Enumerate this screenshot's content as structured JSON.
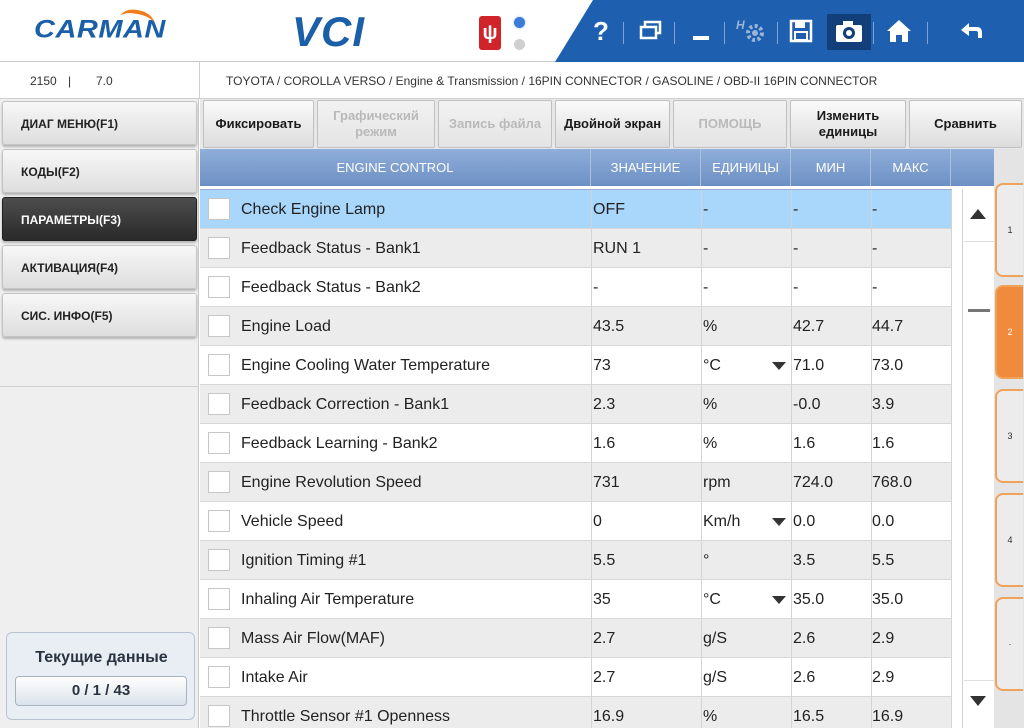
{
  "header": {
    "logo": "CARMAN",
    "product": "VCI",
    "toolbar": [
      "help-icon",
      "window-icon",
      "minimize-icon",
      "settings-icon",
      "save-icon",
      "camera-icon",
      "home-icon",
      "back-icon"
    ]
  },
  "infobar": {
    "version_a": "2150",
    "version_sep": "|",
    "version_b": "7.0",
    "breadcrumb": "TOYOTA / COROLLA VERSO / Engine & Transmission / 16PIN CONNECTOR / GASOLINE / OBD-II 16PIN CONNECTOR"
  },
  "nav": [
    {
      "label": "ДИАГ МЕНЮ(F1)",
      "active": false
    },
    {
      "label": "КОДЫ(F2)",
      "active": false
    },
    {
      "label": "ПАРАМЕТРЫ(F3)",
      "active": true
    },
    {
      "label": "АКТИВАЦИЯ(F4)",
      "active": false
    },
    {
      "label": "СИС. ИНФО(F5)",
      "active": false
    }
  ],
  "current": {
    "title": "Текущие данные",
    "count": "0 / 1 / 43"
  },
  "actions": [
    {
      "label": "Фиксировать",
      "enabled": true
    },
    {
      "label": "Графический режим",
      "enabled": false
    },
    {
      "label": "Запись файла",
      "enabled": false
    },
    {
      "label": "Двойной экран",
      "enabled": true
    },
    {
      "label": "ПОМОЩЬ",
      "enabled": false
    },
    {
      "label": "Изменить единицы",
      "enabled": true
    },
    {
      "label": "Сравнить",
      "enabled": true
    }
  ],
  "table": {
    "headers": [
      "ENGINE CONTROL",
      "ЗНАЧЕНИЕ",
      "ЕДИНИЦЫ",
      "МИН",
      "МАКС"
    ],
    "rows": [
      {
        "name": "Check Engine Lamp",
        "value": "OFF",
        "unit": "-",
        "min": "-",
        "max": "-",
        "dropdown": false
      },
      {
        "name": "Feedback Status - Bank1",
        "value": "RUN 1",
        "unit": "-",
        "min": "-",
        "max": "-",
        "dropdown": false
      },
      {
        "name": "Feedback Status - Bank2",
        "value": "-",
        "unit": "-",
        "min": "-",
        "max": "-",
        "dropdown": false
      },
      {
        "name": "Engine Load",
        "value": "43.5",
        "unit": "%",
        "min": "42.7",
        "max": "44.7",
        "dropdown": false
      },
      {
        "name": "Engine Cooling Water Temperature",
        "value": "73",
        "unit": "°C",
        "min": "71.0",
        "max": "73.0",
        "dropdown": true
      },
      {
        "name": "Feedback Correction - Bank1",
        "value": "2.3",
        "unit": "%",
        "min": "-0.0",
        "max": "3.9",
        "dropdown": false
      },
      {
        "name": "Feedback Learning - Bank2",
        "value": "1.6",
        "unit": "%",
        "min": "1.6",
        "max": "1.6",
        "dropdown": false
      },
      {
        "name": "Engine Revolution Speed",
        "value": "731",
        "unit": "rpm",
        "min": "724.0",
        "max": "768.0",
        "dropdown": false
      },
      {
        "name": "Vehicle Speed",
        "value": "0",
        "unit": "Km/h",
        "min": "0.0",
        "max": "0.0",
        "dropdown": true
      },
      {
        "name": "Ignition Timing #1",
        "value": "5.5",
        "unit": "°",
        "min": "3.5",
        "max": "5.5",
        "dropdown": false
      },
      {
        "name": "Inhaling Air Temperature",
        "value": "35",
        "unit": "°C",
        "min": "35.0",
        "max": "35.0",
        "dropdown": true
      },
      {
        "name": "Mass Air Flow(MAF)",
        "value": "2.7",
        "unit": "g/S",
        "min": "2.6",
        "max": "2.9",
        "dropdown": false
      },
      {
        "name": "Intake Air",
        "value": "2.7",
        "unit": "g/S",
        "min": "2.6",
        "max": "2.9",
        "dropdown": false
      },
      {
        "name": "Throttle Sensor #1 Openness",
        "value": "16.9",
        "unit": "%",
        "min": "16.5",
        "max": "16.9",
        "dropdown": false
      }
    ]
  },
  "pages": [
    "1",
    "2",
    "3",
    "4",
    "·"
  ]
}
